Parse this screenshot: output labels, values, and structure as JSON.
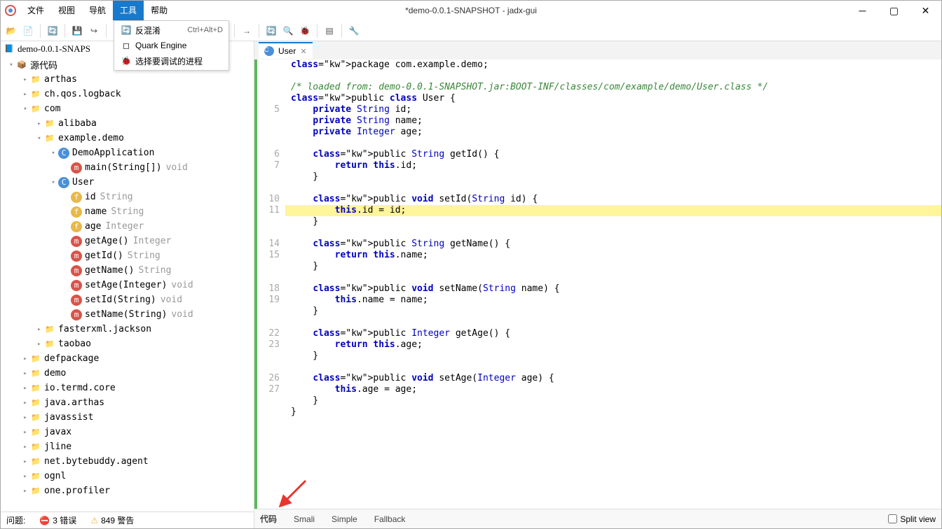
{
  "window_title": "*demo-0.0.1-SNAPSHOT - jadx-gui",
  "menu": {
    "file": "文件",
    "view": "视图",
    "nav": "导航",
    "tools": "工具",
    "help": "帮助"
  },
  "dropdown": {
    "item1": {
      "label": "反混淆",
      "shortcut": "Ctrl+Alt+D"
    },
    "item2": {
      "label": "Quark Engine"
    },
    "item3": {
      "label": "选择要调试的进程"
    }
  },
  "tabs": {
    "root": "demo-0.0.1-SNAPS",
    "src": "源代码"
  },
  "tree": {
    "arthas": "arthas",
    "logback": "ch.qos.logback",
    "com": "com",
    "alibaba": "alibaba",
    "exampledemo": "example.demo",
    "demoapp": "DemoApplication",
    "main": "main(String[])",
    "main_type": "void",
    "user": "User",
    "id": "id",
    "id_type": "String",
    "name": "name",
    "name_type": "String",
    "age": "age",
    "age_type": "Integer",
    "getAge": "getAge()",
    "getAge_type": "Integer",
    "getId": "getId()",
    "getId_type": "String",
    "getName": "getName()",
    "getName_type": "String",
    "setAge": "setAge(Integer)",
    "setAge_type": "void",
    "setId": "setId(String)",
    "setId_type": "void",
    "setName": "setName(String)",
    "setName_type": "void",
    "jackson": "fasterxml.jackson",
    "taobao": "taobao",
    "defpackage": "defpackage",
    "demo": "demo",
    "termd": "io.termd.core",
    "javaarthas": "java.arthas",
    "javassist": "javassist",
    "javax": "javax",
    "jline": "jline",
    "bytebuddy": "net.bytebuddy.agent",
    "ognl": "ognl",
    "profiler": "one.profiler"
  },
  "status": {
    "problems": "问题:",
    "errors": "3 错误",
    "warnings": "849 警告"
  },
  "editor_tab": "User",
  "code": {
    "numbers": [
      "",
      "",
      "",
      "",
      "5",
      "6",
      "7",
      "",
      "",
      "10",
      "11",
      "",
      "",
      "14",
      "15",
      "",
      "",
      "18",
      "19",
      "",
      "",
      "22",
      "23",
      "",
      "",
      "26",
      "27",
      "",
      "",
      ""
    ],
    "lines_plain": [
      "package com.example.demo;",
      "",
      "/* loaded from: demo-0.0.1-SNAPSHOT.jar:BOOT-INF/classes/com/example/demo/User.class */",
      "public class User {",
      "    private String id;",
      "    private String name;",
      "    private Integer age;",
      "",
      "    public String getId() {",
      "        return this.id;",
      "    }",
      "",
      "    public void setId(String id) {",
      "        this.id = id;",
      "    }",
      "",
      "    public String getName() {",
      "        return this.name;",
      "    }",
      "",
      "    public void setName(String name) {",
      "        this.name = name;",
      "    }",
      "",
      "    public Integer getAge() {",
      "        return this.age;",
      "    }",
      "",
      "    public void setAge(Integer age) {",
      "        this.age = age;",
      "    }",
      "}"
    ]
  },
  "bottom": {
    "code": "代码",
    "smali": "Smali",
    "simple": "Simple",
    "fallback": "Fallback",
    "split": "Split view"
  }
}
